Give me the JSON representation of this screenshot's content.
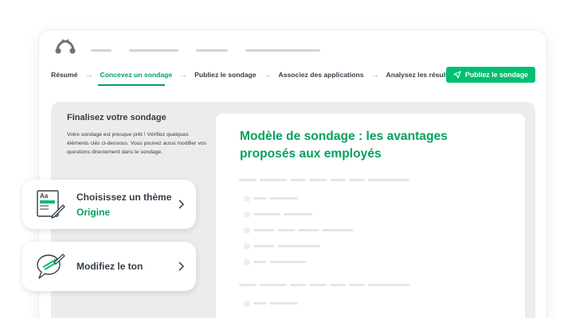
{
  "nav": {
    "steps": [
      "Résumé",
      "Concevez un sondage",
      "Publiez le sondage",
      "Associez des applications",
      "Analysez les résultats"
    ],
    "active_step_index": 1,
    "publish_button": "Publiez le sondage"
  },
  "sidebar": {
    "title": "Finalisez votre sondage",
    "description": "Votre sondage est presque prêt ! Vérifiez quelques éléments clés ci-dessous. Vous pouvez aussi modifier vos questions directement dans le sondage."
  },
  "preview": {
    "title": "Modèle de sondage : les avantages proposés aux employés"
  },
  "cards": {
    "theme": {
      "label": "Choisissez un thème",
      "value": "Origine",
      "icon": "theme-icon"
    },
    "tone": {
      "label": "Modifiez le ton",
      "icon": "tone-icon"
    }
  },
  "colors": {
    "accent": "#00bf6f",
    "accent_text": "#00a25e",
    "text": "#333e48",
    "panel": "#ececec"
  }
}
